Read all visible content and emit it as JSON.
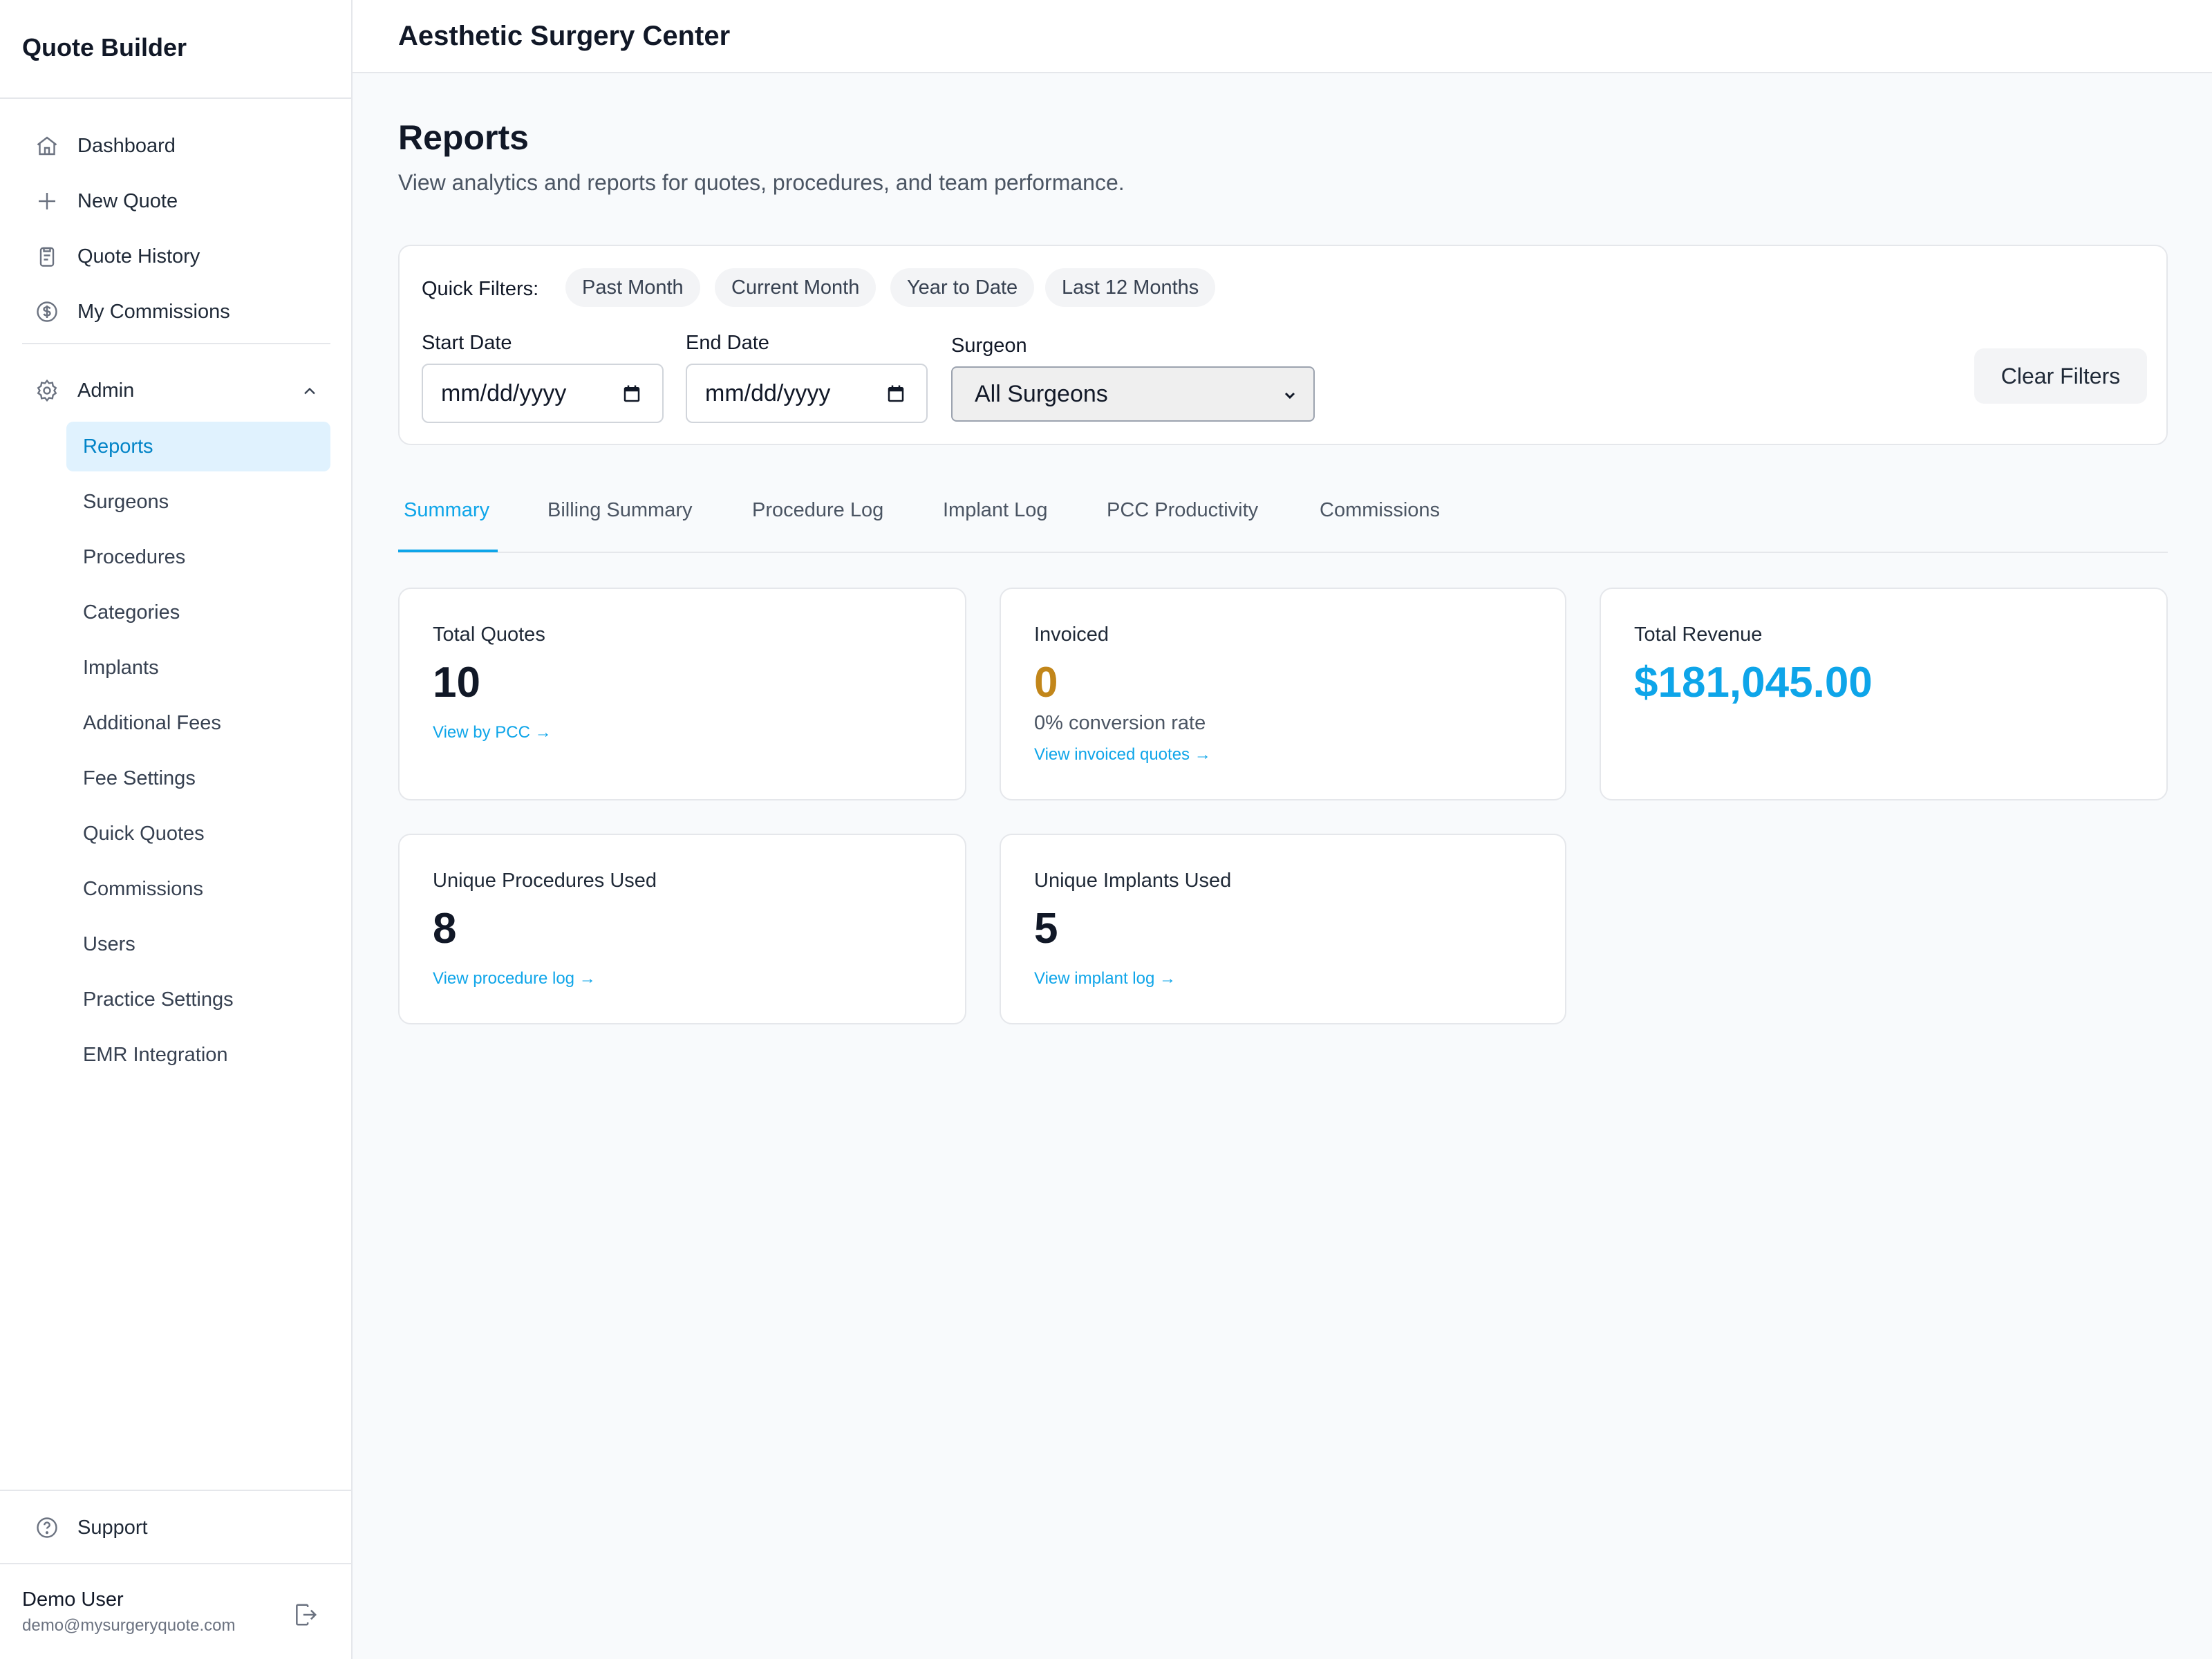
{
  "app": {
    "brand": "Quote Builder",
    "practice_name": "Aesthetic Surgery Center"
  },
  "nav": {
    "items": [
      {
        "label": "Dashboard",
        "icon": "home-icon"
      },
      {
        "label": "New Quote",
        "icon": "plus-icon"
      },
      {
        "label": "Quote History",
        "icon": "clipboard-icon"
      },
      {
        "label": "My Commissions",
        "icon": "dollar-circle-icon"
      }
    ],
    "admin": {
      "label": "Admin",
      "icon": "gear-icon",
      "expanded": true
    },
    "admin_items": [
      {
        "label": "Reports",
        "active": true
      },
      {
        "label": "Surgeons"
      },
      {
        "label": "Procedures"
      },
      {
        "label": "Categories"
      },
      {
        "label": "Implants"
      },
      {
        "label": "Additional Fees"
      },
      {
        "label": "Fee Settings"
      },
      {
        "label": "Quick Quotes"
      },
      {
        "label": "Commissions"
      },
      {
        "label": "Users"
      },
      {
        "label": "Practice Settings"
      },
      {
        "label": "EMR Integration"
      }
    ],
    "support": "Support"
  },
  "user": {
    "name": "Demo User",
    "email": "demo@mysurgeryquote.com"
  },
  "page": {
    "title": "Reports",
    "subtitle": "View analytics and reports for quotes, procedures, and team performance."
  },
  "filters": {
    "quick_label": "Quick Filters:",
    "chips": [
      "Past Month",
      "Current Month",
      "Year to Date",
      "Last 12 Months"
    ],
    "start_label": "Start Date",
    "start_placeholder": "mm/dd/yyyy",
    "end_label": "End Date",
    "end_placeholder": "mm/dd/yyyy",
    "surgeon_label": "Surgeon",
    "surgeon_value": "All Surgeons",
    "clear_label": "Clear Filters"
  },
  "tabs": [
    {
      "label": "Summary",
      "active": true
    },
    {
      "label": "Billing Summary"
    },
    {
      "label": "Procedure Log"
    },
    {
      "label": "Implant Log"
    },
    {
      "label": "PCC Productivity"
    },
    {
      "label": "Commissions"
    }
  ],
  "stats": {
    "total_quotes": {
      "title": "Total Quotes",
      "value": "10",
      "link": "View by PCC →"
    },
    "invoiced": {
      "title": "Invoiced",
      "value": "0",
      "sub": "0% conversion rate",
      "link": "View invoiced quotes →",
      "color": "#c2861a"
    },
    "total_revenue": {
      "title": "Total Revenue",
      "value": "$181,045.00",
      "color": "#0ea5e9"
    },
    "unique_procedures": {
      "title": "Unique Procedures Used",
      "value": "8",
      "link": "View procedure log →"
    },
    "unique_implants": {
      "title": "Unique Implants Used",
      "value": "5",
      "link": "View implant log →"
    }
  },
  "colors": {
    "accent": "#0ea5e9",
    "active_bg": "#e0f2fe",
    "invoiced": "#c2861a"
  }
}
